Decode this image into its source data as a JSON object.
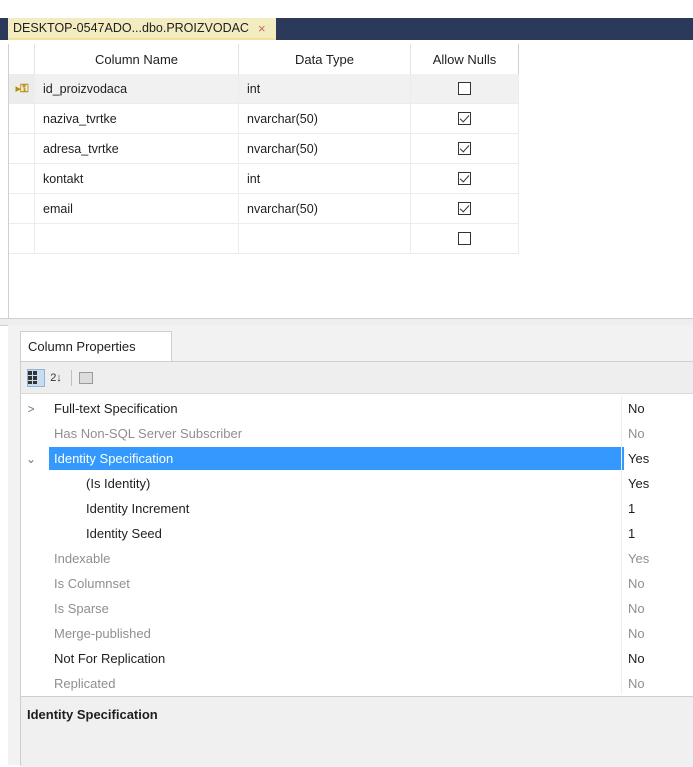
{
  "document_tab": {
    "title": "DESKTOP-0547ADO...dbo.PROIZVODAC",
    "close": "×"
  },
  "grid": {
    "headers": {
      "name": "Column Name",
      "type": "Data Type",
      "nulls": "Allow Nulls"
    },
    "rows": [
      {
        "name": "id_proizvodaca",
        "type": "int",
        "allow_nulls": false,
        "primary_key": true
      },
      {
        "name": "naziva_tvrtke",
        "type": "nvarchar(50)",
        "allow_nulls": true
      },
      {
        "name": "adresa_tvrtke",
        "type": "nvarchar(50)",
        "allow_nulls": true
      },
      {
        "name": "kontakt",
        "type": "int",
        "allow_nulls": true
      },
      {
        "name": "email",
        "type": "nvarchar(50)",
        "allow_nulls": true
      },
      {
        "name": "",
        "type": "",
        "allow_nulls": false
      }
    ],
    "row_indicator": "▸⚿"
  },
  "properties_tab": {
    "label": "Column Properties"
  },
  "toolbar": {
    "categorized_icon": "categorized-icon",
    "alpha_sort_label": "2↓",
    "pages_icon": "property-pages-icon"
  },
  "properties": [
    {
      "name": "Full-text Specification",
      "value": "No",
      "expander": ">",
      "dim": false
    },
    {
      "name": "Has Non-SQL Server Subscriber",
      "value": "No",
      "dim": true
    },
    {
      "name": "Identity Specification",
      "value": "Yes",
      "expander": "⌄",
      "selected": true
    },
    {
      "name": "(Is Identity)",
      "value": "Yes",
      "sub": true
    },
    {
      "name": "Identity Increment",
      "value": "1",
      "sub": true
    },
    {
      "name": "Identity Seed",
      "value": "1",
      "sub": true
    },
    {
      "name": "Indexable",
      "value": "Yes",
      "dim": true
    },
    {
      "name": "Is Columnset",
      "value": "No",
      "dim": true
    },
    {
      "name": "Is Sparse",
      "value": "No",
      "dim": true
    },
    {
      "name": "Merge-published",
      "value": "No",
      "dim": true
    },
    {
      "name": "Not For Replication",
      "value": "No",
      "dim": false
    },
    {
      "name": "Replicated",
      "value": "No",
      "dim": true
    }
  ],
  "description": {
    "title": "Identity Specification"
  },
  "colors": {
    "selection": "#3399ff",
    "tab_active": "#f4ecc1",
    "tabstrip": "#2b3a5a"
  }
}
